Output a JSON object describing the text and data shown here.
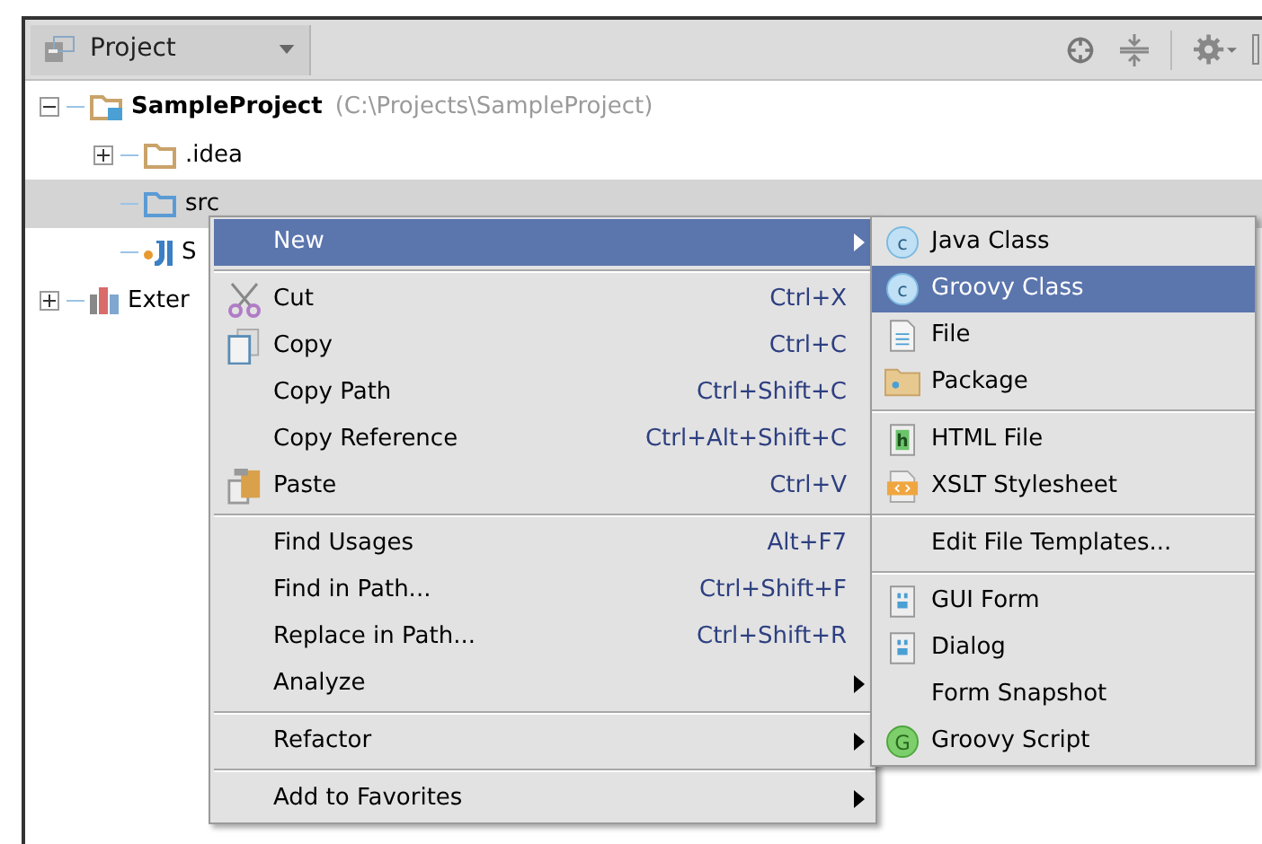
{
  "toolbar": {
    "view_selector": "Project"
  },
  "tree": [
    {
      "label": "SampleProject",
      "path": "(C:\\Projects\\SampleProject)",
      "kind": "project",
      "expanded": true,
      "selected": false,
      "children": [
        {
          "label": ".idea",
          "kind": "folder",
          "expanded": false,
          "selected": false
        },
        {
          "label": "src",
          "kind": "source",
          "selected": true
        },
        {
          "label": "S",
          "kind": "module",
          "selected": false
        }
      ]
    },
    {
      "label": "Exter",
      "kind": "library",
      "expanded": false,
      "selected": false
    }
  ],
  "context_menu": [
    {
      "label": "New",
      "selected": true,
      "submenu": true,
      "separator_before": false
    },
    {
      "label": "Cut",
      "shortcut": "Ctrl+X",
      "kind": "cut",
      "selected": false,
      "separator_before": true
    },
    {
      "label": "Copy",
      "shortcut": "Ctrl+C",
      "kind": "copy",
      "selected": false,
      "separator_before": false
    },
    {
      "label": "Copy Path",
      "shortcut": "Ctrl+Shift+C",
      "selected": false,
      "separator_before": false
    },
    {
      "label": "Copy Reference",
      "shortcut": "Ctrl+Alt+Shift+C",
      "selected": false,
      "separator_before": false
    },
    {
      "label": "Paste",
      "shortcut": "Ctrl+V",
      "kind": "paste",
      "selected": false,
      "separator_before": false
    },
    {
      "label": "Find Usages",
      "shortcut": "Alt+F7",
      "selected": false,
      "separator_before": true
    },
    {
      "label": "Find in Path...",
      "shortcut": "Ctrl+Shift+F",
      "selected": false,
      "separator_before": false
    },
    {
      "label": "Replace in Path...",
      "shortcut": "Ctrl+Shift+R",
      "selected": false,
      "separator_before": false
    },
    {
      "label": "Analyze",
      "submenu": true,
      "selected": false,
      "separator_before": false
    },
    {
      "label": "Refactor",
      "submenu": true,
      "selected": false,
      "separator_before": true
    },
    {
      "label": "Add to Favorites",
      "submenu": true,
      "selected": false,
      "separator_before": true
    }
  ],
  "submenu": [
    {
      "label": "Java Class",
      "kind": "class",
      "icon_text": "c",
      "selected": false,
      "separator_before": false
    },
    {
      "label": "Groovy Class",
      "kind": "class",
      "icon_text": "c",
      "selected": true,
      "separator_before": false
    },
    {
      "label": "File",
      "kind": "file",
      "selected": false,
      "separator_before": false
    },
    {
      "label": "Package",
      "kind": "package",
      "selected": false,
      "separator_before": false
    },
    {
      "label": "HTML File",
      "kind": "html",
      "icon_text": "h",
      "selected": false,
      "separator_before": true
    },
    {
      "label": "XSLT Stylesheet",
      "kind": "xslt",
      "selected": false,
      "separator_before": false
    },
    {
      "label": "Edit File Templates...",
      "selected": false,
      "separator_before": true
    },
    {
      "label": "GUI Form",
      "kind": "form",
      "selected": false,
      "separator_before": true
    },
    {
      "label": "Dialog",
      "kind": "form",
      "selected": false,
      "separator_before": false
    },
    {
      "label": "Form Snapshot",
      "selected": false,
      "separator_before": false
    },
    {
      "label": "Groovy Script",
      "kind": "script",
      "icon_text": "G",
      "selected": false,
      "separator_before": false
    }
  ]
}
